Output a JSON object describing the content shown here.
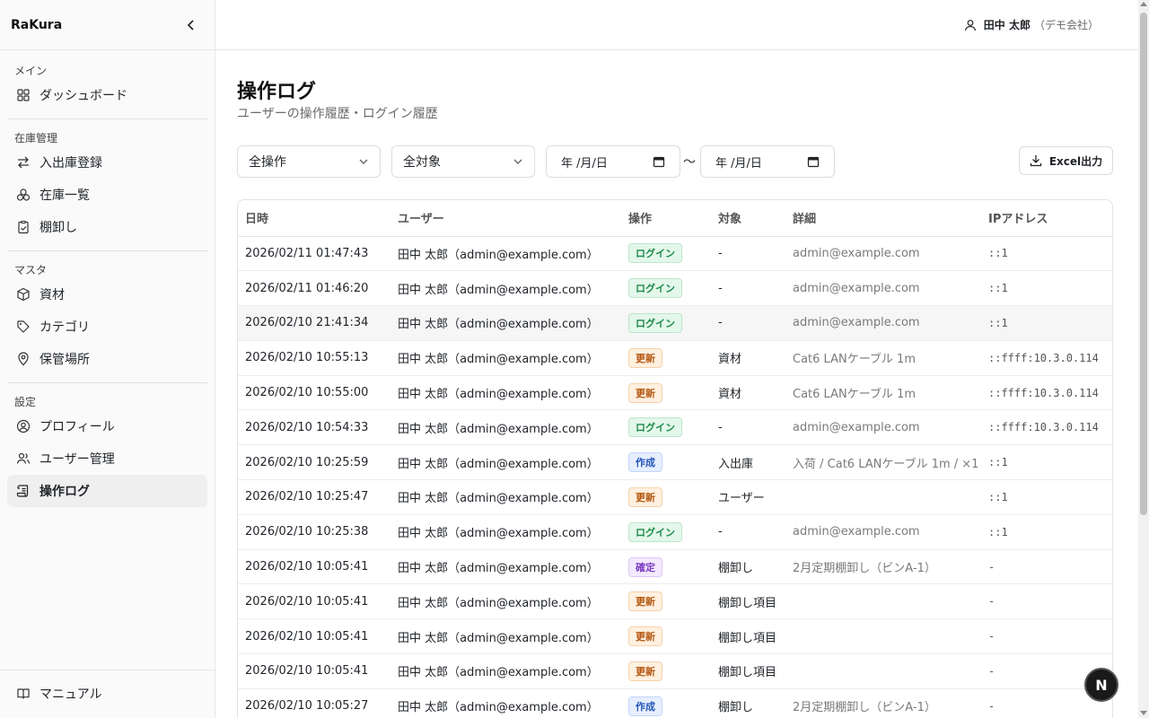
{
  "sidebar": {
    "brand": "RaKura",
    "groups": [
      {
        "title": "メイン",
        "items": [
          {
            "label": "ダッシュボード",
            "icon": "grid-icon"
          }
        ]
      },
      {
        "title": "在庫管理",
        "items": [
          {
            "label": "入出庫登録",
            "icon": "arrows-icon"
          },
          {
            "label": "在庫一覧",
            "icon": "boxes-icon"
          },
          {
            "label": "棚卸し",
            "icon": "clipboard-check-icon"
          }
        ]
      },
      {
        "title": "マスタ",
        "items": [
          {
            "label": "資材",
            "icon": "package-icon"
          },
          {
            "label": "カテゴリ",
            "icon": "tag-icon"
          },
          {
            "label": "保管場所",
            "icon": "map-pin-icon"
          }
        ]
      },
      {
        "title": "設定",
        "items": [
          {
            "label": "プロフィール",
            "icon": "user-circle-icon"
          },
          {
            "label": "ユーザー管理",
            "icon": "users-icon"
          },
          {
            "label": "操作ログ",
            "icon": "scroll-icon",
            "active": true
          }
        ]
      }
    ],
    "footer": {
      "label": "マニュアル",
      "icon": "book-icon"
    }
  },
  "topbar": {
    "user_name": "田中 太郎",
    "org": "（デモ会社）"
  },
  "page": {
    "title": "操作ログ",
    "subtitle": "ユーザーの操作履歴・ログイン履歴"
  },
  "filters": {
    "action": "全操作",
    "target": "全対象",
    "date_from": "年 /月/日",
    "date_to": "年 /月/日",
    "tilde": "〜",
    "excel": "Excel出力"
  },
  "table": {
    "headers": [
      "日時",
      "ユーザー",
      "操作",
      "対象",
      "詳細",
      "IPアドレス"
    ],
    "rows": [
      {
        "datetime": "2026/02/11 01:47:43",
        "user": "田中 太郎（admin@example.com）",
        "action": "ログイン",
        "kind": "login",
        "target": "-",
        "detail": "admin@example.com",
        "ip": "::1"
      },
      {
        "datetime": "2026/02/11 01:46:20",
        "user": "田中 太郎（admin@example.com）",
        "action": "ログイン",
        "kind": "login",
        "target": "-",
        "detail": "admin@example.com",
        "ip": "::1"
      },
      {
        "datetime": "2026/02/10 21:41:34",
        "user": "田中 太郎（admin@example.com）",
        "action": "ログイン",
        "kind": "login",
        "target": "-",
        "detail": "admin@example.com",
        "ip": "::1",
        "hl": true
      },
      {
        "datetime": "2026/02/10 10:55:13",
        "user": "田中 太郎（admin@example.com）",
        "action": "更新",
        "kind": "update",
        "target": "資材",
        "detail": "Cat6 LANケーブル 1m",
        "ip": "::ffff:10.3.0.114"
      },
      {
        "datetime": "2026/02/10 10:55:00",
        "user": "田中 太郎（admin@example.com）",
        "action": "更新",
        "kind": "update",
        "target": "資材",
        "detail": "Cat6 LANケーブル 1m",
        "ip": "::ffff:10.3.0.114"
      },
      {
        "datetime": "2026/02/10 10:54:33",
        "user": "田中 太郎（admin@example.com）",
        "action": "ログイン",
        "kind": "login",
        "target": "-",
        "detail": "admin@example.com",
        "ip": "::ffff:10.3.0.114"
      },
      {
        "datetime": "2026/02/10 10:25:59",
        "user": "田中 太郎（admin@example.com）",
        "action": "作成",
        "kind": "create",
        "target": "入出庫",
        "detail": "入荷 / Cat6 LANケーブル 1m / ×1",
        "ip": "::1"
      },
      {
        "datetime": "2026/02/10 10:25:47",
        "user": "田中 太郎（admin@example.com）",
        "action": "更新",
        "kind": "update",
        "target": "ユーザー",
        "detail": "",
        "ip": "::1"
      },
      {
        "datetime": "2026/02/10 10:25:38",
        "user": "田中 太郎（admin@example.com）",
        "action": "ログイン",
        "kind": "login",
        "target": "-",
        "detail": "admin@example.com",
        "ip": "::1"
      },
      {
        "datetime": "2026/02/10 10:05:41",
        "user": "田中 太郎（admin@example.com）",
        "action": "確定",
        "kind": "confirm",
        "target": "棚卸し",
        "detail": "2月定期棚卸し（ビンA-1）",
        "ip": "-"
      },
      {
        "datetime": "2026/02/10 10:05:41",
        "user": "田中 太郎（admin@example.com）",
        "action": "更新",
        "kind": "update",
        "target": "棚卸し項目",
        "detail": "",
        "ip": "-"
      },
      {
        "datetime": "2026/02/10 10:05:41",
        "user": "田中 太郎（admin@example.com）",
        "action": "更新",
        "kind": "update",
        "target": "棚卸し項目",
        "detail": "",
        "ip": "-"
      },
      {
        "datetime": "2026/02/10 10:05:41",
        "user": "田中 太郎（admin@example.com）",
        "action": "更新",
        "kind": "update",
        "target": "棚卸し項目",
        "detail": "",
        "ip": "-"
      },
      {
        "datetime": "2026/02/10 10:05:27",
        "user": "田中 太郎（admin@example.com）",
        "action": "作成",
        "kind": "create",
        "target": "棚卸し",
        "detail": "2月定期棚卸し（ビンA-1）",
        "ip": "-"
      }
    ]
  },
  "fab": {
    "label": "N"
  }
}
